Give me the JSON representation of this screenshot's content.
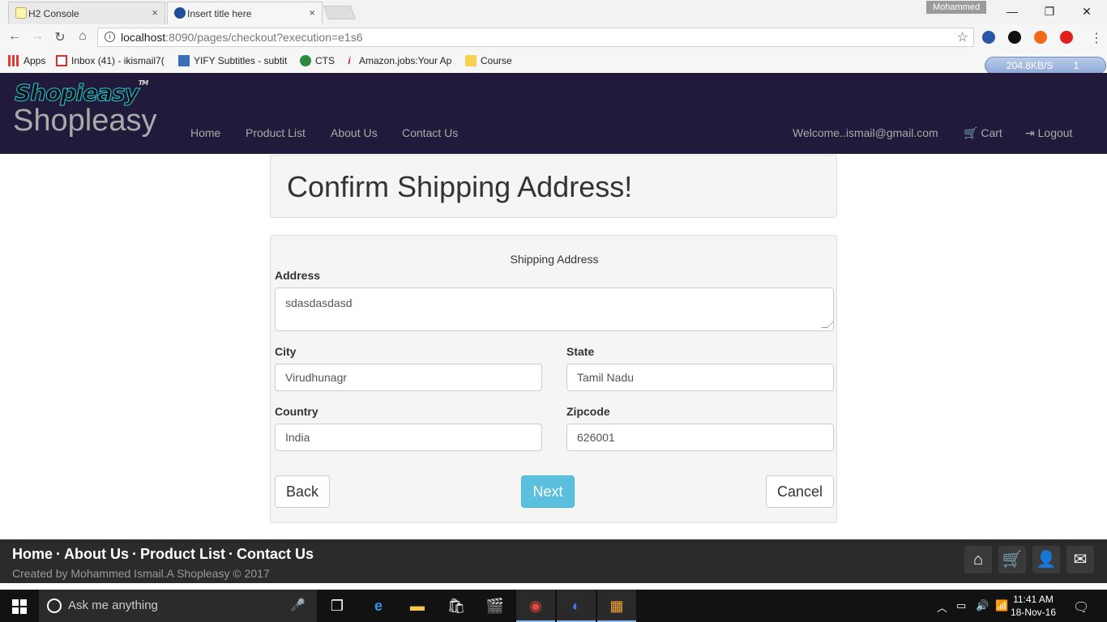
{
  "browser": {
    "tabs": [
      {
        "title": "H2 Console",
        "close": "×"
      },
      {
        "title": "Insert title here",
        "close": "×"
      }
    ],
    "profile_name": "Mohammed",
    "window_controls": {
      "minimize": "—",
      "restore": "❐",
      "close": "✕"
    },
    "url_host": "localhost",
    "url_rest": ":8090/pages/checkout?execution=e1s6",
    "bookmarks": [
      {
        "label": "Apps",
        "icon": "apps-grid-icon"
      },
      {
        "label": "Inbox (41) - ikismail7(",
        "icon": "gmail-icon"
      },
      {
        "label": "YIFY Subtitles - subtit",
        "icon": "yify-icon"
      },
      {
        "label": "CTS",
        "icon": "globe-icon"
      },
      {
        "label": "Amazon.jobs:Your Ap",
        "icon": "info-icon"
      },
      {
        "label": "Course",
        "icon": "folder-icon"
      }
    ],
    "speed_meter": {
      "rate": "204.8KB/S",
      "count": "1"
    }
  },
  "site": {
    "logo_text": "Shopieasy",
    "logo_tm": "TM",
    "brand": "Shopleasy",
    "nav": [
      "Home",
      "Product List",
      "About Us",
      "Contact Us"
    ],
    "welcome": "Welcome..ismail@gmail.com",
    "cart": "Cart",
    "logout": "Logout"
  },
  "page": {
    "heading": "Confirm Shipping Address!",
    "panel_title": "Shipping Address",
    "fields": {
      "address": {
        "label": "Address",
        "value": "sdasdasdasd"
      },
      "city": {
        "label": "City",
        "value": "Virudhunagr"
      },
      "state": {
        "label": "State",
        "value": "Tamil Nadu"
      },
      "country": {
        "label": "Country",
        "value": "India"
      },
      "zipcode": {
        "label": "Zipcode",
        "value": "626001"
      }
    },
    "buttons": {
      "back": "Back",
      "next": "Next",
      "cancel": "Cancel"
    },
    "colors": {
      "navbar": "#221a3a",
      "next_button": "#5bc0de",
      "footer": "#2b2b2b"
    }
  },
  "footer": {
    "links": [
      "Home",
      "About Us",
      "Product List",
      "Contact Us"
    ],
    "separator": "·",
    "credit": "Created by Mohammed Ismail.A Shopleasy © 2017",
    "icons": [
      "home-icon",
      "cart-icon",
      "user-icon",
      "envelope-icon"
    ]
  },
  "taskbar": {
    "search_placeholder": "Ask me anything",
    "time": "11:41 AM",
    "date": "18-Nov-16"
  }
}
